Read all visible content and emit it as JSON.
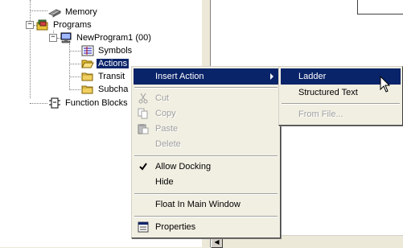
{
  "tree": {
    "memory": "Memory",
    "programs": "Programs",
    "program": "NewProgram1 (00)",
    "symbols": "Symbols",
    "actions": "Actions",
    "transitions": "Transit",
    "subcharts": "Subcha",
    "function_blocks": "Function Blocks"
  },
  "context_menu": {
    "insert_action": "Insert Action",
    "cut": "Cut",
    "copy": "Copy",
    "paste": "Paste",
    "delete": "Delete",
    "allow_docking": "Allow Docking",
    "hide": "Hide",
    "float_in_main_window": "Float In Main Window",
    "properties": "Properties"
  },
  "submenu": {
    "ladder": "Ladder",
    "structured_text": "Structured Text",
    "from_file": "From File..."
  },
  "colors": {
    "highlight": "#0a246a",
    "menu_bg": "#f1efe2"
  }
}
